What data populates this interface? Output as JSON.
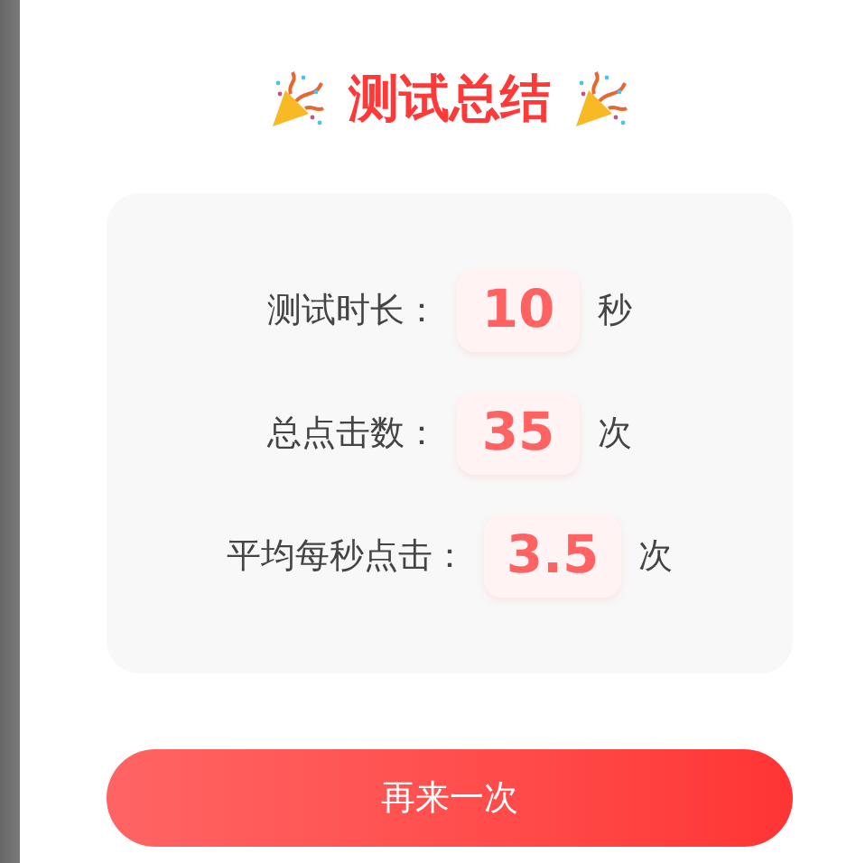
{
  "title": "测试总结",
  "stats": [
    {
      "label": "测试时长：",
      "value": "10",
      "unit": "秒"
    },
    {
      "label": "总点击数：",
      "value": "35",
      "unit": "次"
    },
    {
      "label": "平均每秒点击：",
      "value": "3.5",
      "unit": "次"
    }
  ],
  "button": "再来一次"
}
